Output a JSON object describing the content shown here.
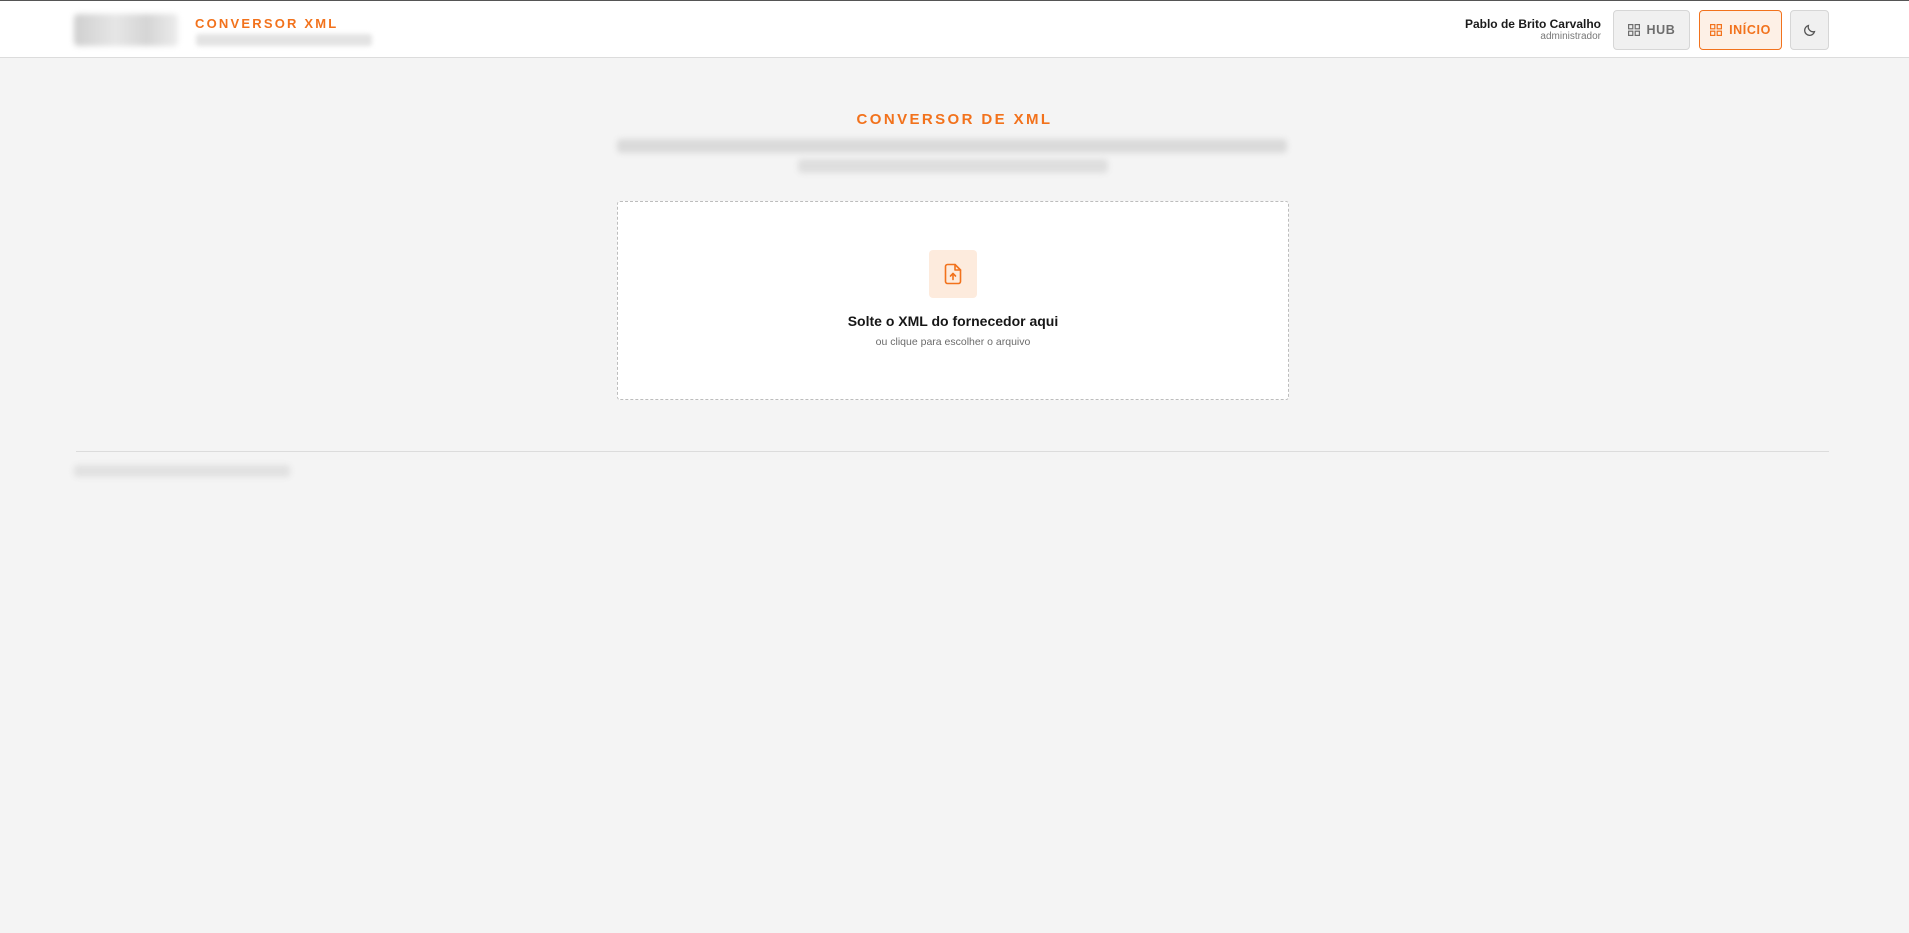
{
  "header": {
    "brand_title": "CONVERSOR XML",
    "user": {
      "name": "Pablo de Brito Carvalho",
      "role": "administrador"
    },
    "buttons": {
      "hub_label": "HUB",
      "inicio_label": "INÍCIO"
    },
    "icons": {
      "hub": "grid-icon",
      "inicio": "grid-icon",
      "theme": "moon-icon"
    }
  },
  "main": {
    "title": "CONVERSOR DE XML",
    "dropzone": {
      "title": "Solte o XML do fornecedor aqui",
      "subtitle": "ou clique para escolher o arquivo",
      "icon": "file-upload-icon"
    }
  },
  "colors": {
    "accent": "#f2721c",
    "accent_soft": "#fdebdd",
    "background": "#f4f4f4"
  }
}
